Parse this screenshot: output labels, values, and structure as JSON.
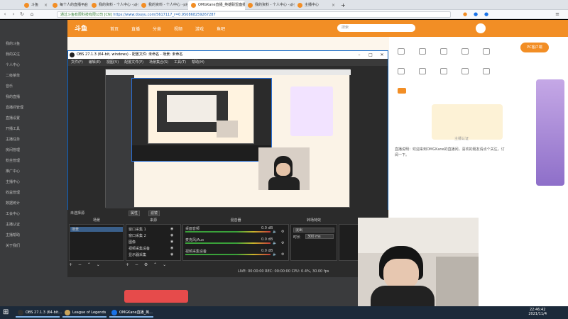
{
  "browser": {
    "tabs": [
      {
        "label": "斗鱼",
        "color": "#f28e25"
      },
      {
        "label": "每个人的直播平台",
        "color": "#f28e25"
      },
      {
        "label": "我的资料 - 个人中心 - 斗鱼",
        "color": "#f28e25"
      },
      {
        "label": "我的资料 - 个人中心 - 斗鱼",
        "color": "#f28e25"
      },
      {
        "label": "OMGKane直播_英雄联盟直播_斗鱼",
        "color": "#f28e25"
      },
      {
        "label": "我的资料 - 个人中心 - 斗鱼",
        "color": "#f28e25"
      },
      {
        "label": "主播中心",
        "color": "#f28e25"
      }
    ],
    "add_tab": "+",
    "url_prefix": "通过斗鱼有限科技有限公司 [CN]",
    "url": "https://www.douyu.com/5617117_r=0.950868259267287"
  },
  "douyu": {
    "logo": "斗鱼",
    "nav": [
      "首页",
      "直播",
      "分类",
      "视频",
      "游戏",
      "鱼吧"
    ],
    "search_placeholder": "搜索",
    "left_menu": [
      "我的斗鱼",
      "我的关注",
      "个人中心",
      "二级菜单",
      "音乐",
      "我的直播",
      "直播间管理",
      "直播设置",
      "开播工具",
      "主播任务",
      "房间管理",
      "粉丝管理",
      "推广中心",
      "主播中心",
      "收益管理",
      "数据统计",
      "工会中心",
      "主播认证",
      "主播帮助",
      "关于我们"
    ],
    "sidebar_right": [
      "主播认证",
      "PC客户端",
      "直播间",
      "主播中心"
    ],
    "bottom_banner": "主播认证",
    "desc": "直播说明：欢迎来到OMGKane的直播间，喜欢的朋友请点个关注，订阅一下。"
  },
  "obs": {
    "title": "OBS 27.1.3 (64-bit, windows) - 配置文件: 未命名 - 场景: 未命名",
    "menu": [
      "文件(F)",
      "编辑(E)",
      "视图(V)",
      "配置文件(P)",
      "场景集合(S)",
      "工具(T)",
      "帮助(H)"
    ],
    "scene_bar_label": "未选择源",
    "properties_btn": "属性",
    "filters_btn": "滤镜",
    "docks": {
      "scenes": "场景",
      "sources": "来源",
      "mixer": "混音器",
      "transitions": "转场特效",
      "controls": "控件"
    },
    "scenes": [
      "场景"
    ],
    "sources": [
      "窗口采集 1",
      "窗口采集 2",
      "图像",
      "视频采集设备",
      "显示器采集"
    ],
    "mixer": [
      {
        "name": "桌面音频",
        "db": "0.0 dB"
      },
      {
        "name": "麦克风/Aux",
        "db": "0.0 dB"
      },
      {
        "name": "视频采集设备",
        "db": "0.0 dB"
      }
    ],
    "transition": "淡出",
    "duration_label": "时长",
    "duration": "300 ms",
    "status": "LIVE: 00:00:00   REC: 00:00:00   CPU: 0.4%, 30.00 fps"
  },
  "taskbar": {
    "items": [
      {
        "label": "OBS 27.1.3 (64-bit...",
        "color": "#333"
      },
      {
        "label": "League of Legends",
        "color": "#c9a45a"
      },
      {
        "label": "OMGKane直播_英...",
        "color": "#1a73e8"
      }
    ],
    "time": "22:46:42",
    "date": "2021/11/4"
  }
}
